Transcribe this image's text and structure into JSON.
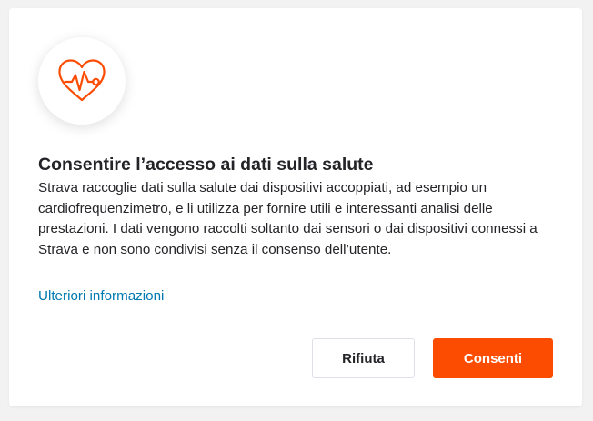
{
  "dialog": {
    "icon": "heart-pulse-icon",
    "title": "Consentire l’accesso ai dati sulla salute",
    "description": "Strava raccoglie dati sulla salute dai dispositivi accoppiati, ad esempio un cardiofrequenzimetro, e li utilizza per fornire utili e interessanti analisi delle prestazioni. I dati vengono raccolti soltanto dai sensori o dai dispositivi connessi a Strava e non sono condivisi senza il consenso dell’utente.",
    "more_info_link": "Ulteriori informazioni",
    "decline_label": "Rifiuta",
    "accept_label": "Consenti"
  },
  "colors": {
    "brand_orange": "#fc4c02",
    "link_blue": "#0079b0",
    "text": "#242428"
  }
}
